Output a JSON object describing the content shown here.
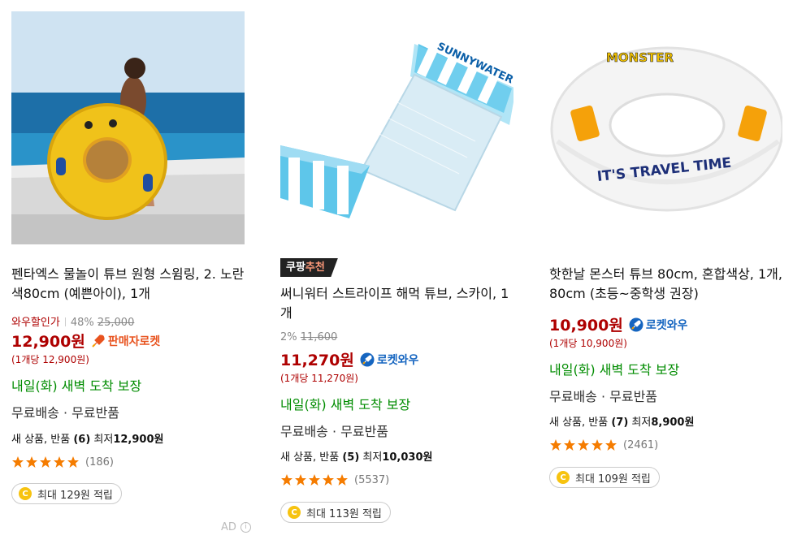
{
  "products": [
    {
      "title": "펜타엑스 물놀이 튜브 원형 스윔링, 2. 노란색80cm (예쁜아이), 1개",
      "discount_label": "와우할인가",
      "discount_percent": "48%",
      "original_price": "25,000",
      "price": "12,900원",
      "rocket_label": "판매자로켓",
      "unit_price": "(1개당 12,900원)",
      "delivery": "내일(화) 새벽 도착 보장",
      "shipping": "무료배송 · 무료반품",
      "used_prefix": "새 상품, 반품 ",
      "used_count": "(6)",
      "used_mid": " 최저",
      "used_price": "12,900원",
      "review_count": "(186)",
      "rating": 5,
      "reward": "최대 129원 적립"
    },
    {
      "badge_main": "쿠팡",
      "badge_accent": "추천",
      "title": "써니워터 스트라이프 해먹 튜브, 스카이, 1개",
      "discount_percent": "2%",
      "original_price": "11,600",
      "price": "11,270원",
      "rocket_label": "로켓와우",
      "unit_price": "(1개당 11,270원)",
      "delivery": "내일(화) 새벽 도착 보장",
      "shipping": "무료배송 · 무료반품",
      "used_prefix": "새 상품, 반품 ",
      "used_count": "(5)",
      "used_mid": " 최저",
      "used_price": "10,030원",
      "review_count": "(5537)",
      "rating": 5,
      "reward": "최대 113원 적립",
      "image_text": "SUNNYWATER"
    },
    {
      "title": "핫한날 몬스터 튜브 80cm, 혼합색상, 1개, 80cm (초등~중학생 권장)",
      "price": "10,900원",
      "rocket_label": "로켓와우",
      "unit_price": "(1개당 10,900원)",
      "delivery": "내일(화) 새벽 도착 보장",
      "shipping": "무료배송 · 무료반품",
      "used_prefix": "새 상품, 반품 ",
      "used_count": "(7)",
      "used_mid": " 최저",
      "used_price": "8,900원",
      "review_count": "(2461)",
      "rating": 5,
      "reward": "최대 109원 적립",
      "image_text": "IT'S TRAVEL TIME",
      "image_brand": "MONSTER"
    }
  ],
  "ad_label": "AD",
  "ad_info_glyph": "i",
  "coin_glyph": "C",
  "colors": {
    "price_red": "#ae0000",
    "delivery_green": "#008c00",
    "star_orange": "#f57c00",
    "rocket_wow_blue": "#1565c0",
    "seller_rocket_orange": "#e8531f"
  }
}
